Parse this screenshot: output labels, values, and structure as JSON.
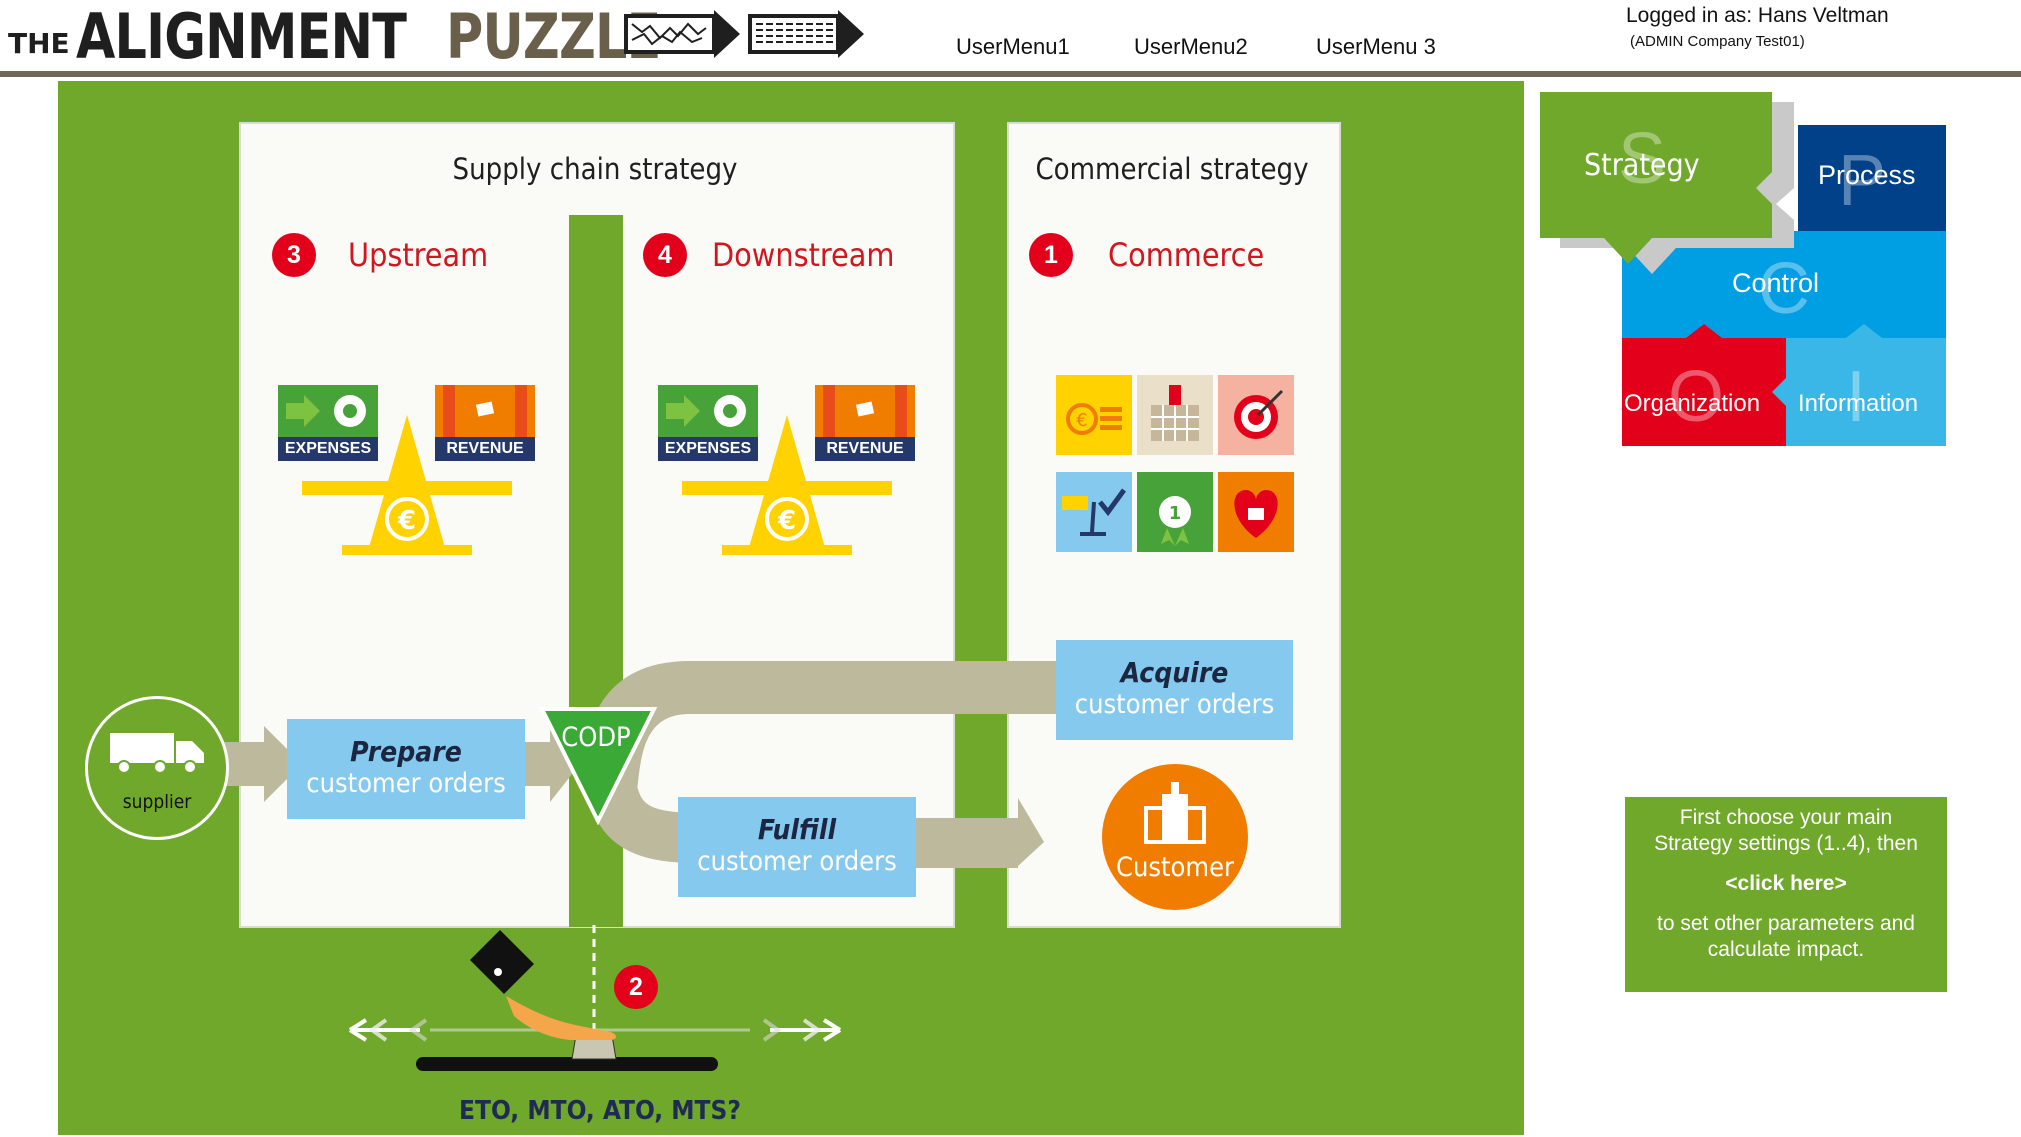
{
  "header": {
    "brand_the": "THE",
    "brand_alignment": "ALIGNMENT",
    "brand_puzzle": "PUZZLE",
    "menu": [
      "UserMenu1",
      "UserMenu2",
      "UserMenu 3"
    ],
    "login_text": "Logged in as: Hans Veltman",
    "company_text": "(ADMIN Company Test01)"
  },
  "supply_chain": {
    "title": "Supply chain strategy",
    "upstream": {
      "number": "3",
      "label": "Upstream",
      "expenses": "EXPENSES",
      "revenue": "REVENUE"
    },
    "downstream": {
      "number": "4",
      "label": "Downstream",
      "expenses": "EXPENSES",
      "revenue": "REVENUE"
    }
  },
  "commercial": {
    "title": "Commercial strategy",
    "number": "1",
    "label": "Commerce",
    "tile_icons": [
      "coins-icon",
      "factory-icon",
      "target-icon",
      "scale-check-icon",
      "award-icon",
      "heart-icon"
    ]
  },
  "flow": {
    "supplier": "supplier",
    "prepare": [
      "Prepare",
      "customer orders"
    ],
    "codp": "CODP",
    "acquire": [
      "Acquire",
      "customer orders"
    ],
    "fulfill": [
      "Fulfill",
      "customer orders"
    ],
    "customer": "Customer",
    "slider_number": "2",
    "slider_label": "ETO, MTO, ATO, MTS?"
  },
  "puzzle": {
    "strategy": "Strategy",
    "strategy_letter": "S",
    "process": "Process",
    "process_letter": "P",
    "control": "Control",
    "control_letter": "C",
    "organization": "Organization",
    "organization_letter": "O",
    "information": "Information",
    "information_letter": "I"
  },
  "info": {
    "line1": "First choose your main",
    "line2": "Strategy settings (1..4), then",
    "link": "<click here>",
    "line3": "to set other parameters and",
    "line4": "calculate impact."
  },
  "colors": {
    "green": "#6fa82a",
    "red": "#e3001b",
    "blue_light": "#85c9ee",
    "orange": "#f07d00",
    "yellow": "#ffd200",
    "puzzle_darkblue": "#00418a",
    "puzzle_blue": "#009fe3",
    "puzzle_cyan": "#3ab7e6",
    "header_line": "#6f675a"
  }
}
